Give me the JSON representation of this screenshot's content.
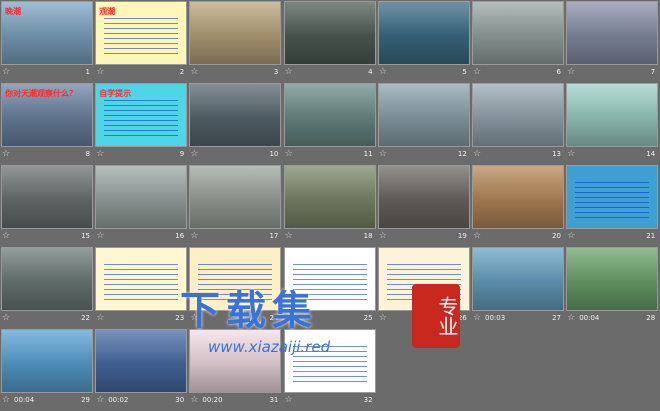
{
  "slides": [
    {
      "n": "1",
      "title": "晚潮",
      "bg": "#7fa6c4",
      "kind": "photo"
    },
    {
      "n": "2",
      "title": "观潮",
      "bg": "#fff6b8",
      "kind": "text"
    },
    {
      "n": "3",
      "title": "",
      "bg": "#bba67e",
      "kind": "photo"
    },
    {
      "n": "4",
      "title": "",
      "bg": "#526058",
      "kind": "photo"
    },
    {
      "n": "5",
      "title": "",
      "bg": "#3e6f86",
      "kind": "photo"
    },
    {
      "n": "6",
      "title": "",
      "bg": "#9aa7a4",
      "kind": "photo"
    },
    {
      "n": "7",
      "title": "",
      "bg": "#8b92aa",
      "kind": "photo"
    },
    {
      "n": "8",
      "title": "你对天潮观察什么？",
      "bg": "#6f86a4",
      "kind": "photo"
    },
    {
      "n": "9",
      "title": "自学提示",
      "bg": "#4fd6e6",
      "kind": "text"
    },
    {
      "n": "10",
      "title": "",
      "bg": "#5b6a72",
      "kind": "photo"
    },
    {
      "n": "11",
      "title": "",
      "bg": "#6e8e8a",
      "kind": "photo"
    },
    {
      "n": "12",
      "title": "",
      "bg": "#8ea5ad",
      "kind": "photo"
    },
    {
      "n": "13",
      "title": "",
      "bg": "#9aaab4",
      "kind": "photo"
    },
    {
      "n": "14",
      "title": "",
      "bg": "#9ed2c8",
      "kind": "photo"
    },
    {
      "n": "15",
      "title": "",
      "bg": "#6d7373",
      "kind": "photo"
    },
    {
      "n": "16",
      "title": "",
      "bg": "#9ea9a6",
      "kind": "photo"
    },
    {
      "n": "17",
      "title": "",
      "bg": "#9ea69e",
      "kind": "photo"
    },
    {
      "n": "18",
      "title": "",
      "bg": "#7e8a6c",
      "kind": "photo"
    },
    {
      "n": "19",
      "title": "",
      "bg": "#6e6b64",
      "kind": "photo"
    },
    {
      "n": "20",
      "title": "",
      "bg": "#b88b5b",
      "kind": "photo"
    },
    {
      "n": "21",
      "title": "",
      "bg": "#3f9fd2",
      "kind": "text"
    },
    {
      "n": "22",
      "title": "",
      "bg": "#6f7d7a",
      "kind": "photo"
    },
    {
      "n": "23",
      "title": "",
      "bg": "#fff6d2",
      "kind": "text"
    },
    {
      "n": "24",
      "title": "",
      "bg": "#ffefc4",
      "kind": "text"
    },
    {
      "n": "25",
      "title": "",
      "bg": "#ffffff",
      "kind": "text"
    },
    {
      "n": "26",
      "title": "",
      "bg": "#fbf4d8",
      "kind": "text"
    },
    {
      "n": "27",
      "title": "",
      "bg": "#6aa4c4",
      "kind": "photo"
    },
    {
      "n": "28",
      "title": "",
      "bg": "#6ea66e",
      "kind": "photo"
    },
    {
      "n": "29",
      "title": "",
      "bg": "#5aa4d6",
      "kind": "photo"
    },
    {
      "n": "30",
      "title": "",
      "bg": "#4a6ea8",
      "kind": "photo"
    },
    {
      "n": "31",
      "title": "",
      "bg": "#f4dfe6",
      "kind": "photo"
    },
    {
      "n": "32",
      "title": "",
      "bg": "#ffffff",
      "kind": "text"
    }
  ],
  "captions": [
    {
      "n": "1",
      "time": ""
    },
    {
      "n": "2",
      "time": ""
    },
    {
      "n": "3",
      "time": ""
    },
    {
      "n": "4",
      "time": ""
    },
    {
      "n": "5",
      "time": ""
    },
    {
      "n": "6",
      "time": ""
    },
    {
      "n": "7",
      "time": ""
    },
    {
      "n": "8",
      "time": ""
    },
    {
      "n": "9",
      "time": ""
    },
    {
      "n": "10",
      "time": ""
    },
    {
      "n": "11",
      "time": ""
    },
    {
      "n": "12",
      "time": ""
    },
    {
      "n": "13",
      "time": ""
    },
    {
      "n": "14",
      "time": ""
    },
    {
      "n": "15",
      "time": ""
    },
    {
      "n": "16",
      "time": ""
    },
    {
      "n": "17",
      "time": ""
    },
    {
      "n": "18",
      "time": ""
    },
    {
      "n": "19",
      "time": ""
    },
    {
      "n": "20",
      "time": ""
    },
    {
      "n": "21",
      "time": ""
    },
    {
      "n": "22",
      "time": ""
    },
    {
      "n": "23",
      "time": ""
    },
    {
      "n": "24",
      "time": ""
    },
    {
      "n": "25",
      "time": ""
    },
    {
      "n": "26",
      "time": ""
    },
    {
      "n": "27",
      "time": "00:03"
    },
    {
      "n": "28",
      "time": "00:04"
    },
    {
      "n": "29",
      "time": "00:04"
    },
    {
      "n": "30",
      "time": "00:02"
    },
    {
      "n": "31",
      "time": "00:20"
    },
    {
      "n": "32",
      "time": ""
    }
  ],
  "watermark": {
    "title": "下载集",
    "url": "www.xiazaiji.red",
    "seal": "专业"
  },
  "colors": {
    "background": "#6b6b6b",
    "caption_text": "#f0f0f0",
    "title_red": "#ff2a2a",
    "body_blue": "#0033cc",
    "watermark_blue": "#3b73d4",
    "seal_red": "#c8281e"
  }
}
